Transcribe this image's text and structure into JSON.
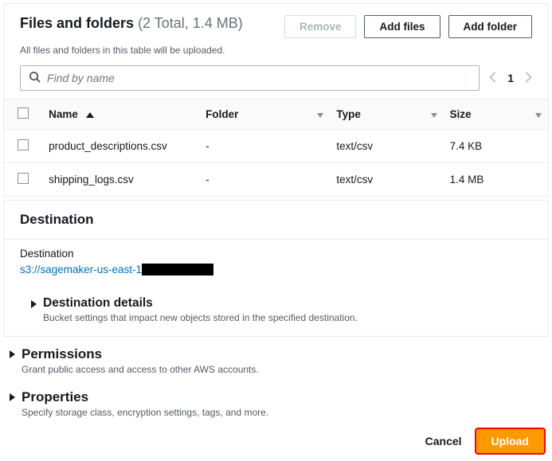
{
  "files_panel": {
    "title": "Files and folders",
    "summary": "(2 Total, 1.4 MB)",
    "subtitle": "All files and folders in this table will be uploaded.",
    "remove_label": "Remove",
    "add_files_label": "Add files",
    "add_folder_label": "Add folder",
    "search_placeholder": "Find by name",
    "page_number": "1",
    "columns": {
      "name": "Name",
      "folder": "Folder",
      "type": "Type",
      "size": "Size"
    },
    "rows": [
      {
        "name": "product_descriptions.csv",
        "folder": "-",
        "type": "text/csv",
        "size": "7.4 KB"
      },
      {
        "name": "shipping_logs.csv",
        "folder": "-",
        "type": "text/csv",
        "size": "1.4 MB"
      }
    ]
  },
  "destination_panel": {
    "title": "Destination",
    "label": "Destination",
    "link_text": "s3://sagemaker-us-east-1",
    "details_title": "Destination details",
    "details_sub": "Bucket settings that impact new objects stored in the specified destination."
  },
  "permissions": {
    "title": "Permissions",
    "sub": "Grant public access and access to other AWS accounts."
  },
  "properties": {
    "title": "Properties",
    "sub": "Specify storage class, encryption settings, tags, and more."
  },
  "footer": {
    "cancel": "Cancel",
    "upload": "Upload"
  }
}
